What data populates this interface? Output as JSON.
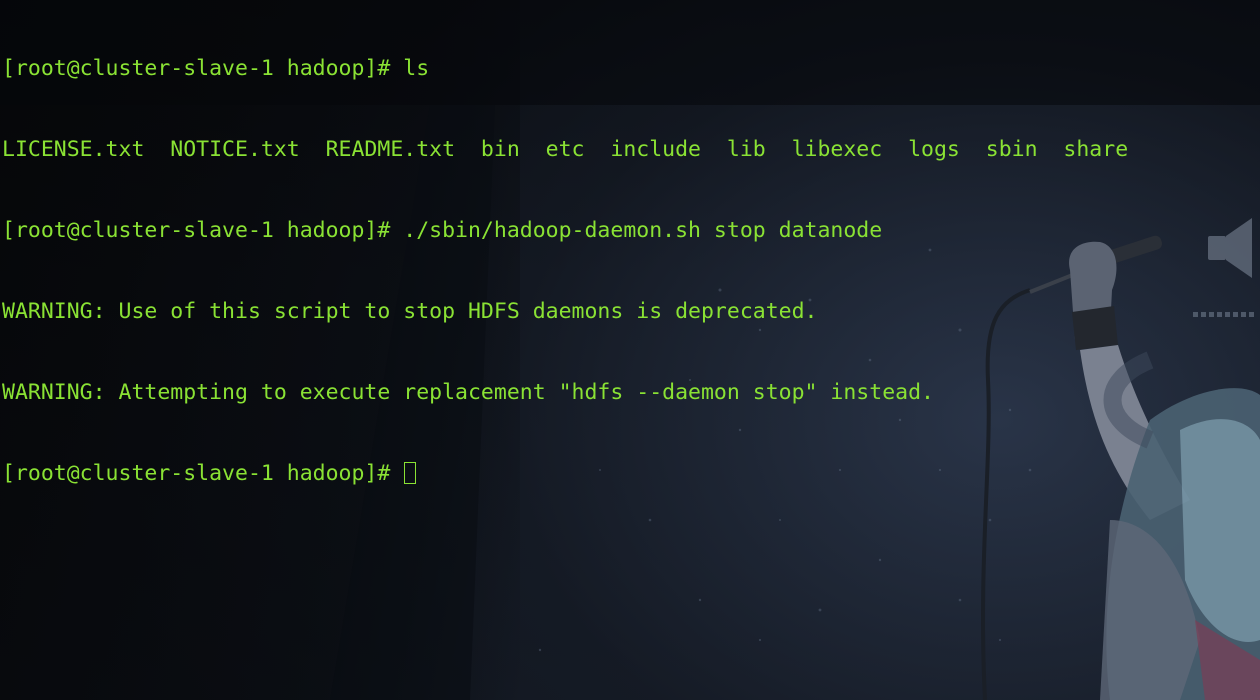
{
  "terminal": {
    "lines": [
      "[root@cluster-slave-1 hadoop]# ls",
      "LICENSE.txt  NOTICE.txt  README.txt  bin  etc  include  lib  libexec  logs  sbin  share",
      "[root@cluster-slave-1 hadoop]# ./sbin/hadoop-daemon.sh stop datanode",
      "WARNING: Use of this script to stop HDFS daemons is deprecated.",
      "WARNING: Attempting to execute replacement \"hdfs --daemon stop\" instead."
    ],
    "prompt": "[root@cluster-slave-1 hadoop]# ",
    "text_color": "#8ae234",
    "background_color": "#0d1117"
  },
  "wallpaper": {
    "icons": [
      "speaker-icon"
    ]
  }
}
